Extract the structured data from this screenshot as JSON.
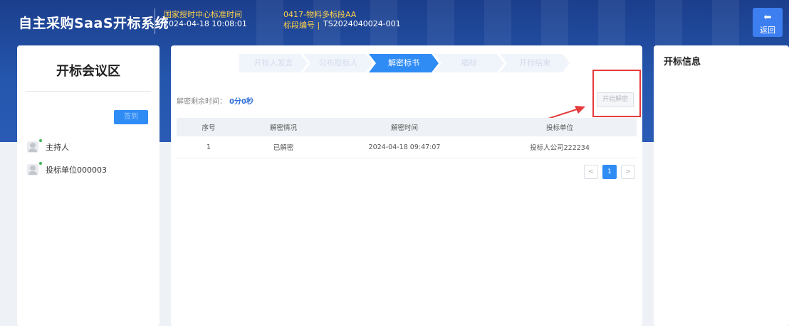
{
  "header": {
    "app_title": "自主采购SaaS开标系统",
    "time_label": "国家授时中心标准时间",
    "time_value": "2024-04-18 10:08:01",
    "project_name": "0417-物料多标段AA",
    "bid_code_label": "标段编号 |",
    "bid_code_value": "TS2024040024-001",
    "back_label": "返回",
    "back_icon": "arrow-left-icon"
  },
  "left_panel": {
    "title": "开标会议区",
    "sign_button": "签到",
    "participants": [
      {
        "name": "主持人",
        "online": true
      },
      {
        "name": "投标单位000003",
        "online": true
      }
    ]
  },
  "center_panel": {
    "steps": [
      {
        "label": "开标人发言",
        "state": "done"
      },
      {
        "label": "公布投标人",
        "state": "done"
      },
      {
        "label": "解密标书",
        "state": "active"
      },
      {
        "label": "唱标",
        "state": "pending"
      },
      {
        "label": "开标结束",
        "state": "pending"
      }
    ],
    "remain_label": "解密剩余时间：",
    "remain_value": "0分0秒",
    "start_button": "开始解密",
    "table": {
      "columns": [
        "序号",
        "解密情况",
        "解密时间",
        "投标单位"
      ],
      "rows": [
        [
          "1",
          "已解密",
          "2024-04-18 09:47:07",
          "投标人公司222234"
        ]
      ]
    },
    "pagination": {
      "prev": "<",
      "current": "1",
      "next": ">"
    }
  },
  "right_panel": {
    "title": "开标信息"
  },
  "colors": {
    "header": "#2456ad",
    "accent": "#2f8cf5",
    "highlight": "#e53b3b",
    "time_label": "#ffd24a"
  }
}
